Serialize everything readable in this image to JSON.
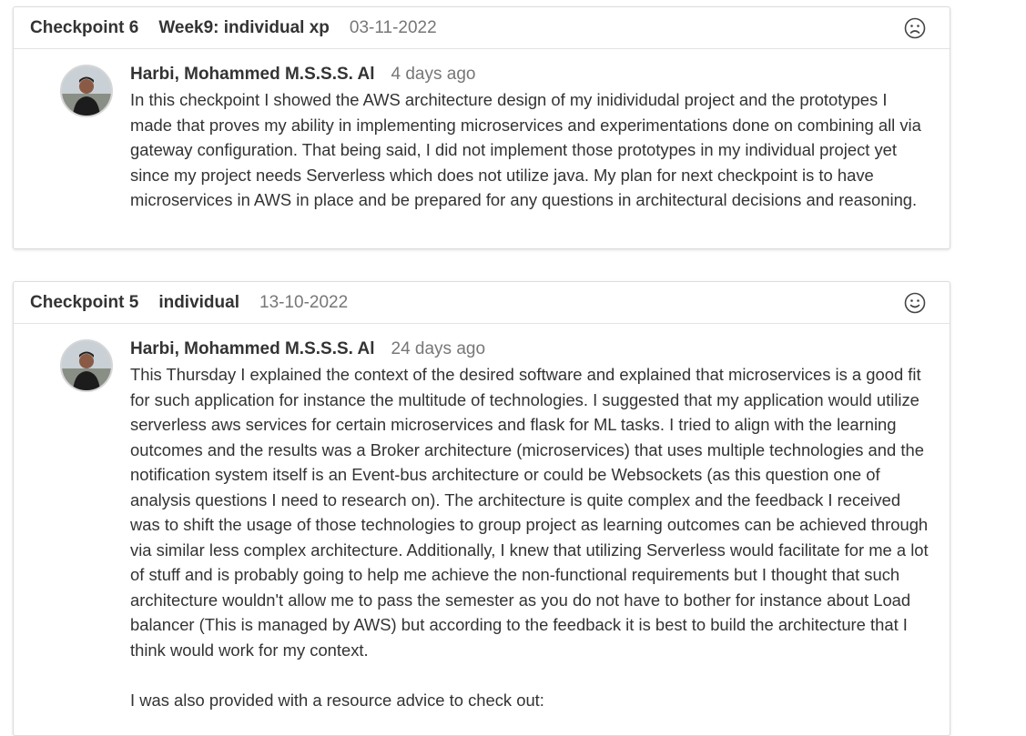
{
  "checkpoints": [
    {
      "title": "Checkpoint 6",
      "name": "Week9: individual xp",
      "date": "03-11-2022",
      "mood_icon": "sad-face-icon",
      "comment": {
        "author": "Harbi, Mohammed M.S.S.S. Al",
        "time": "4 days ago",
        "paragraphs": [
          "In this checkpoint I showed the AWS architecture design of my inidividudal project and the prototypes I made that proves my ability in implementing microservices and experimentations done on combining all via gateway configuration. That being said, I did not implement those prototypes in my individual project yet since my project needs Serverless which does not utilize java. My plan for next checkpoint is to have microservices in AWS in place and be prepared for any questions in architectural decisions and reasoning."
        ]
      }
    },
    {
      "title": "Checkpoint 5",
      "name": "individual",
      "date": "13-10-2022",
      "mood_icon": "happy-face-icon",
      "comment": {
        "author": "Harbi, Mohammed M.S.S.S. Al",
        "time": "24 days ago",
        "paragraphs": [
          "This Thursday I explained the context of the desired software and explained that microservices is a good fit for such application for instance the multitude of technologies. I suggested that my application would utilize serverless aws services for certain microservices and flask for ML tasks. I tried to align with the learning outcomes and the results was a Broker architecture (microservices) that uses multiple technologies and the notification system itself is an Event-bus architecture or could be Websockets (as this question one of analysis questions I need to research on). The architecture is quite complex and the feedback I received was to shift  the usage of those technologies to group project as learning outcomes can be achieved through via similar less complex architecture. Additionally, I knew that utilizing Serverless would facilitate for me a lot of stuff and is probably going to help me achieve the non-functional requirements but I thought that such architecture wouldn't allow me to pass the semester as you do not have to bother for instance about Load balancer (This is managed by AWS) but according to the feedback it is best to build the architecture that I think would work for my context.",
          "I was also provided with a resource advice to check out:"
        ]
      }
    }
  ]
}
